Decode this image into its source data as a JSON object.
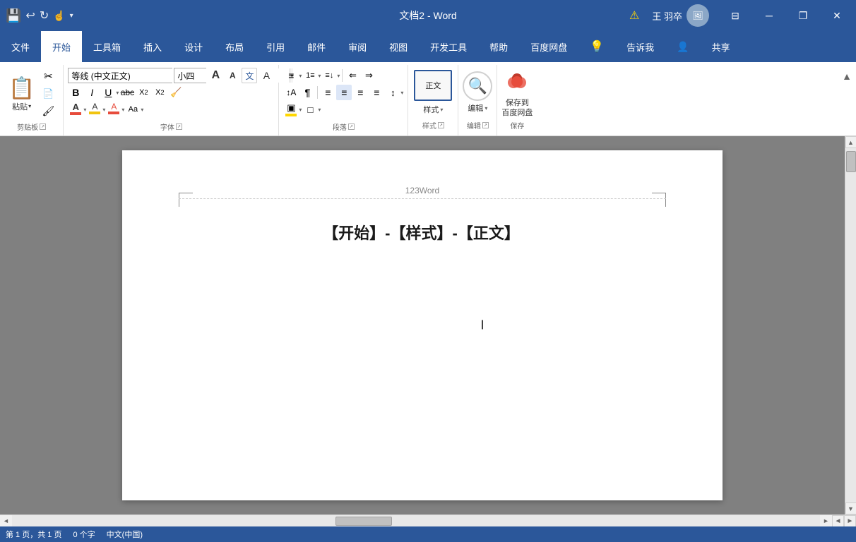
{
  "titlebar": {
    "title": "文档2 - Word",
    "warning_icon": "⚠",
    "user_name": "王 羽卒",
    "minimize_icon": "─",
    "restore_icon": "❐",
    "close_icon": "✕",
    "group_icon": "⊟",
    "quick_save": "💾",
    "undo": "↩",
    "redo": "↻",
    "customize": "▾"
  },
  "menubar": {
    "items": [
      {
        "id": "file",
        "label": "文件"
      },
      {
        "id": "home",
        "label": "开始",
        "active": true
      },
      {
        "id": "tools",
        "label": "工具箱"
      },
      {
        "id": "insert",
        "label": "插入"
      },
      {
        "id": "design",
        "label": "设计"
      },
      {
        "id": "layout",
        "label": "布局"
      },
      {
        "id": "references",
        "label": "引用"
      },
      {
        "id": "mailing",
        "label": "邮件"
      },
      {
        "id": "review",
        "label": "审阅"
      },
      {
        "id": "view",
        "label": "视图"
      },
      {
        "id": "developer",
        "label": "开发工具"
      },
      {
        "id": "help",
        "label": "帮助"
      },
      {
        "id": "baidu_pan",
        "label": "百度网盘"
      },
      {
        "id": "lightbulb",
        "label": "💡"
      },
      {
        "id": "tell_me",
        "label": "告诉我"
      },
      {
        "id": "share_icon",
        "label": "👤"
      },
      {
        "id": "share",
        "label": "共享"
      }
    ]
  },
  "ribbon": {
    "clipboard": {
      "paste_label": "粘贴",
      "group_label": "剪贴板",
      "cut_label": "✂",
      "copy_label": "📋",
      "format_painter_label": "🖌"
    },
    "font": {
      "font_name": "等线 (中文正文)",
      "font_size": "小四",
      "grow_label": "A",
      "shrink_label": "A",
      "wen_label": "文",
      "clear_label": "A",
      "bold_label": "B",
      "italic_label": "I",
      "underline_label": "U",
      "strikethrough_label": "abc",
      "subscript_label": "X₂",
      "superscript_label": "X²",
      "eraser_label": "🧹",
      "font_color_label": "A",
      "highlight_label": "A",
      "font_shading_label": "A",
      "case_label": "Aa",
      "group_label": "字体"
    },
    "paragraph": {
      "bullets_label": "≡",
      "numbering_label": "1≡",
      "multi_level_label": "≡↓",
      "decrease_indent_label": "⇐",
      "increase_indent_label": "⇒",
      "sort_label": "↕A",
      "show_marks_label": "¶",
      "align_left_label": "≡",
      "align_center_label": "≡",
      "align_right_label": "≡",
      "justify_label": "≡",
      "line_spacing_label": "↕",
      "shading_label": "▣",
      "borders_label": "□",
      "group_label": "段落"
    },
    "styles": {
      "label": "样式",
      "group_label": "样式"
    },
    "editing": {
      "label": "编辑",
      "group_label": "编辑"
    },
    "save": {
      "line1": "保存到",
      "line2": "百度网盘",
      "group_label": "保存"
    }
  },
  "document": {
    "header_text": "123Word",
    "content_text": "【开始】-【样式】-【正文】",
    "cursor_visible": true
  },
  "statusbar": {
    "page_info": "第 1 页，共 1 页",
    "word_count": "0 个字",
    "lang": "中文(中国)"
  },
  "scrollbar": {
    "up": "▲",
    "down": "▼",
    "left": "◄",
    "right": "►"
  }
}
